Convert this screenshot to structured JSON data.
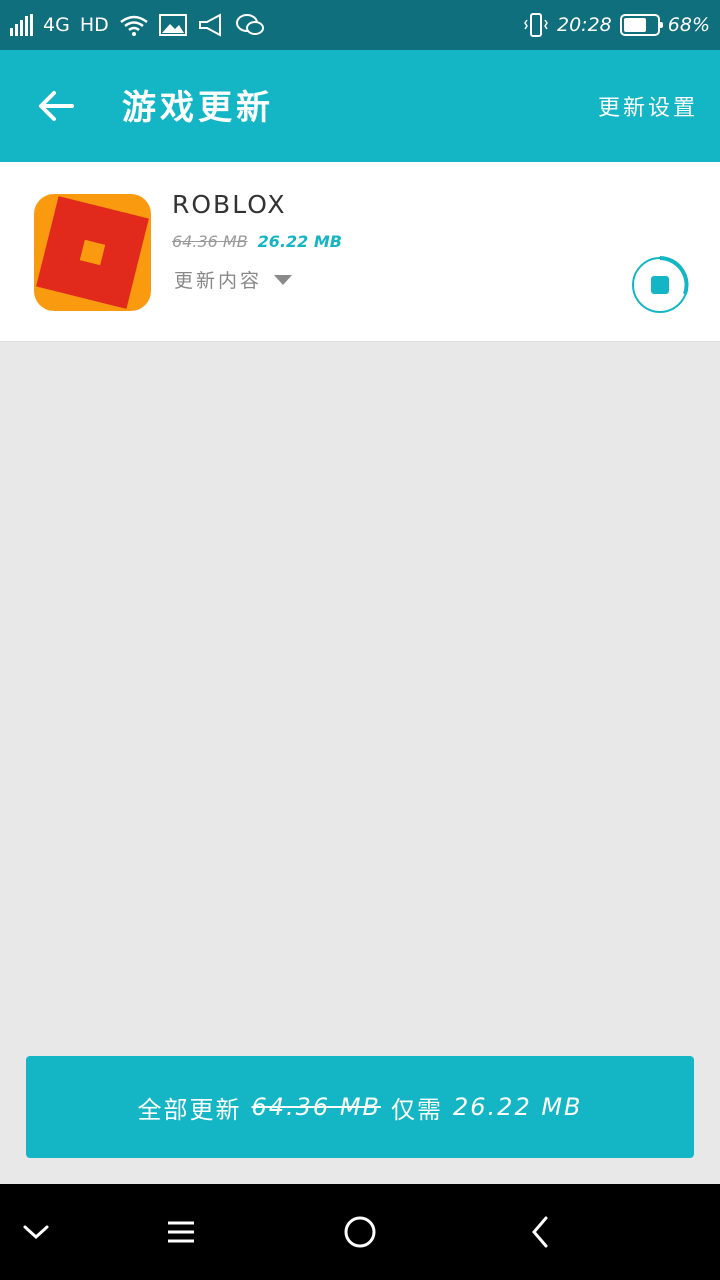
{
  "status_bar": {
    "sim": "2",
    "network": "4G",
    "hd": "HD",
    "time": "20:28",
    "battery_text": "68%",
    "battery_level": 0.68
  },
  "header": {
    "title": "游戏更新",
    "settings_label": "更新设置"
  },
  "apps": [
    {
      "name": "ROBLOX",
      "old_size": "64.36 MB",
      "new_size": "26.22 MB",
      "update_content_label": "更新内容"
    }
  ],
  "update_all": {
    "prefix": "全部更新",
    "old_size": "64.36 MB",
    "mid": "仅需",
    "new_size": "26.22 MB"
  },
  "colors": {
    "accent": "#14b6c5",
    "status_bar": "#0f6f7c",
    "background": "#e8e8e8"
  },
  "icons": {
    "back": "arrow-left-icon",
    "nav_down": "chevron-down-icon",
    "nav_menu": "menu-icon",
    "nav_home": "home-circle-icon",
    "nav_back": "chevron-left-icon",
    "progress": "download-progress-stop-icon"
  }
}
